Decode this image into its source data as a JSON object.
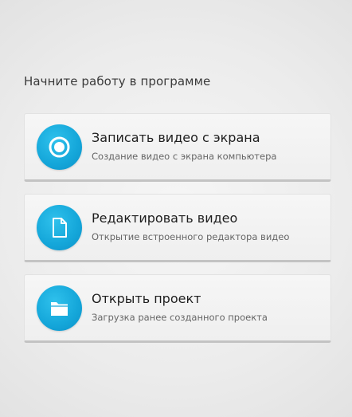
{
  "heading": "Начните работу в программе",
  "actions": [
    {
      "title": "Записать видео с экрана",
      "subtitle": "Создание видео с экрана компьютера",
      "icon": "record-icon"
    },
    {
      "title": "Редактировать видео",
      "subtitle": "Открытие встроенного редактора видео",
      "icon": "document-icon"
    },
    {
      "title": "Открыть проект",
      "subtitle": "Загрузка ранее созданного проекта",
      "icon": "folder-icon"
    }
  ],
  "colors": {
    "accent": "#14a6d9",
    "card_background": "#f3f3f3",
    "title_text": "#1e1e1e",
    "subtitle_text": "#666666"
  }
}
